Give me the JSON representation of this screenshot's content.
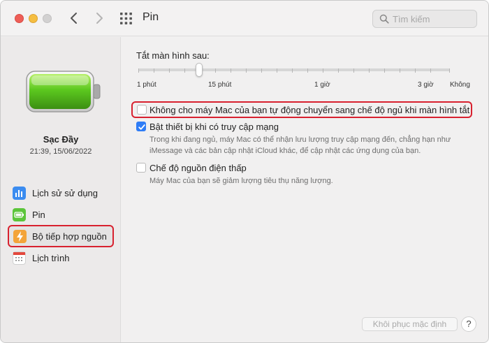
{
  "window": {
    "title": "Pin"
  },
  "search": {
    "placeholder": "Tìm kiếm"
  },
  "sidebar": {
    "charge_label": "Sạc Đầy",
    "charge_time": "21:39, 15/06/2022",
    "items": [
      {
        "label": "Lịch sử sử dụng",
        "icon": "bar-chart-icon"
      },
      {
        "label": "Pin",
        "icon": "battery-icon"
      },
      {
        "label": "Bộ tiếp hợp nguồn",
        "icon": "power-adapter-icon"
      },
      {
        "label": "Lịch trình",
        "icon": "calendar-icon"
      }
    ]
  },
  "slider": {
    "title": "Tắt màn hình sau:",
    "ticks": [
      "1 phút",
      "15 phút",
      "1 giờ",
      "3 giờ",
      "Không"
    ],
    "value": "15 phút"
  },
  "options": [
    {
      "label": "Không cho máy Mac của bạn tự động chuyển sang chế độ ngủ khi màn hình tắt",
      "checked": false,
      "desc": ""
    },
    {
      "label": "Bật thiết bị khi có truy cập mạng",
      "checked": true,
      "desc_line1": "Trong khi đang ngủ, máy Mac có thể nhận lưu lượng truy cập mạng đến, chẳng hạn như",
      "desc_line2": "iMessage và các bản cập nhật iCloud khác, để cập nhật các ứng dụng của bạn."
    },
    {
      "label": "Chế độ nguồn điện thấp",
      "checked": false,
      "desc_line1": "Máy Mac của bạn sẽ giảm lượng tiêu thụ năng lượng."
    }
  ],
  "footer": {
    "restore_label": "Khôi phục mặc định",
    "help_label": "?"
  },
  "colors": {
    "highlight": "#d8212f",
    "accent": "#2f7df6"
  }
}
